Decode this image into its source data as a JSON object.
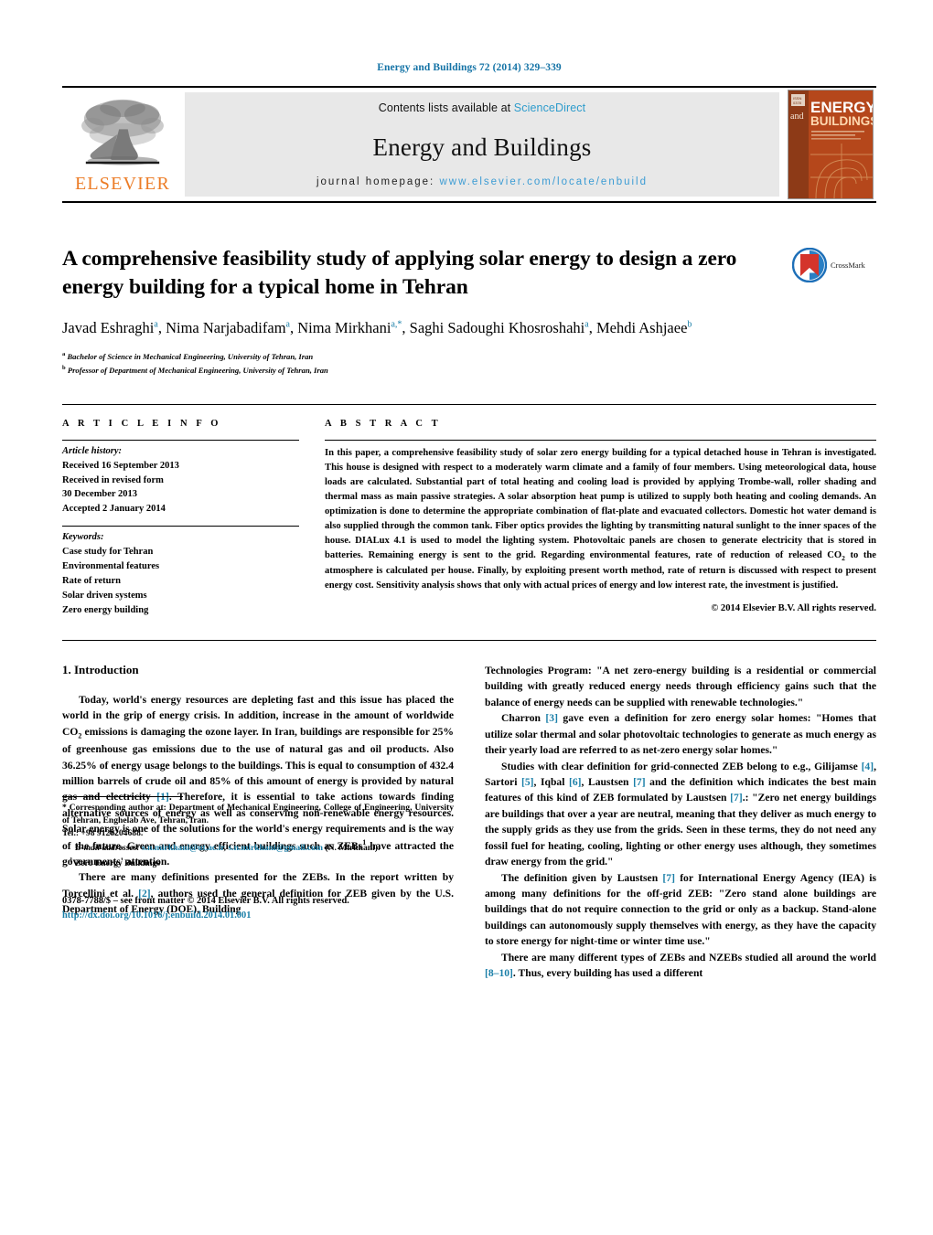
{
  "running_head": "Energy and Buildings 72 (2014) 329–339",
  "masthead": {
    "publisher_name": "ELSEVIER",
    "contents_prefix": "Contents lists available at ",
    "contents_link": "ScienceDirect",
    "journal_name": "Energy and Buildings",
    "homepage_prefix": "journal homepage: ",
    "homepage_url": "www.elsevier.com/locate/enbuild",
    "cover_title_line1": "ENERGY",
    "cover_title_line2": "BUILDINGS",
    "cover_and": "and"
  },
  "article": {
    "title": "A comprehensive feasibility study of applying solar energy to design a zero energy building for a typical home in Tehran",
    "crossmark_label": "CrossMark",
    "authors_html": "Javad Eshraghi<sup>a</sup>, Nima Narjabadifam<sup>a</sup>, Nima Mirkhani<sup>a,*</sup>, Saghi Sadoughi Khosroshahi<sup>a</sup>, Mehdi Ashjaee<sup>b</sup>",
    "affiliations": [
      "Bachelor of Science in Mechanical Engineering, University of Tehran, Iran",
      "Professor of Department of Mechanical Engineering, University of Tehran, Iran"
    ],
    "affiliation_marks": [
      "a",
      "b"
    ]
  },
  "article_info": {
    "heading": "A R T I C L E    I N F O",
    "history_label": "Article history:",
    "history_lines": [
      "Received 16 September 2013",
      "Received in revised form",
      "30 December 2013",
      "Accepted 2 January 2014"
    ],
    "keywords_label": "Keywords:",
    "keywords": [
      "Case study for Tehran",
      "Environmental features",
      "Rate of return",
      "Solar driven systems",
      "Zero energy building"
    ]
  },
  "abstract": {
    "heading": "A B S T R A C T",
    "text_html": "In this paper, a comprehensive feasibility study of solar zero energy building for a typical detached house in Tehran is investigated. This house is designed with respect to a moderately warm climate and a family of four members. Using meteorological data, house loads are calculated. Substantial part of total heating and cooling load is provided by applying Trombe-wall, roller shading and thermal mass as main passive strategies. A solar absorption heat pump is utilized to supply both heating and cooling demands. An optimization is done to determine the appropriate combination of flat-plate and evacuated collectors. Domestic hot water demand is also supplied through the common tank. Fiber optics provides the lighting by transmitting natural sunlight to the inner spaces of the house. DIALux 4.1 is used to model the lighting system. Photovoltaic panels are chosen to generate electricity that is stored in batteries. Remaining energy is sent to the grid. Regarding environmental features, rate of reduction of released CO<sub>2</sub> to the atmosphere is calculated per house. Finally, by exploiting present worth method, rate of return is discussed with respect to present energy cost. Sensitivity analysis shows that only with actual prices of energy and low interest rate, the investment is justified.",
    "copyright": "© 2014 Elsevier B.V. All rights reserved."
  },
  "body": {
    "section_number_title": "1.  Introduction",
    "left_paragraphs_html": [
      "Today, world's energy resources are depleting fast and this issue has placed the world in the grip of energy crisis. In addition, increase in the amount of worldwide CO<sub>2</sub> emissions is damaging the ozone layer. In Iran, buildings are responsible for 25% of greenhouse gas emissions due to the use of natural gas and oil products. Also 36.25% of energy usage belongs to the buildings. This is equal to consumption of 432.4 million barrels of crude oil and 85% of this amount of energy is provided by natural gas and electricity <span class=\"ref\">[1]</span>. Therefore, it is essential to take actions towards finding alternative sources of energy as well as conserving non-renewable energy resources. Solar energy is one of the solutions for the world's energy requirements and is the way of the future. Green and energy efficient buildings such as ZEBs<sup>1</sup> have attracted the governments' attention.",
      "There are many definitions presented for the ZEBs. In the report written by Torcellini et al. <span class=\"ref\">[2]</span>, authors used the general definition for ZEB given by the U.S. Department of Energy (DOE), Building"
    ],
    "right_paragraphs_html": [
      "Technologies Program: \"A net zero-energy building is a residential or commercial building with greatly reduced energy needs through efficiency gains such that the balance of energy needs can be supplied with renewable technologies.\"",
      "Charron <span class=\"ref\">[3]</span> gave even a definition for zero energy solar homes: \"Homes that utilize solar thermal and solar photovoltaic technologies to generate as much energy as their yearly load are referred to as net-zero energy solar homes.\"",
      "Studies with clear definition for grid-connected ZEB belong to e.g., Gilijamse <span class=\"ref\">[4]</span>, Sartori <span class=\"ref\">[5]</span>, Iqbal <span class=\"ref\">[6]</span>, Laustsen <span class=\"ref\">[7]</span> and the definition which indicates the best main features of this kind of ZEB formulated by Laustsen <span class=\"ref\">[7]</span>.: \"Zero net energy buildings are buildings that over a year are neutral, meaning that they deliver as much energy to the supply grids as they use from the grids. Seen in these terms, they do not need any fossil fuel for heating, cooling, lighting or other energy uses although, they sometimes draw energy from the grid.\"",
      "The definition given by Laustsen <span class=\"ref\">[7]</span> for International Energy Agency (IEA) is among many definitions for the off-grid ZEB: \"Zero stand alone buildings are buildings that do not require connection to the grid or only as a backup. Stand-alone buildings can autonomously supply themselves with energy, as they have the capacity to store energy for night-time or winter time use.\"",
      "There are many different types of ZEBs and NZEBs studied all around the world <span class=\"ref\">[8–10]</span>. Thus, every building has used a different"
    ]
  },
  "footnotes": {
    "corresponding_html": "<b>*</b>  Corresponding author at: Department of Mechanical Engineering, College of Engineering, University of Tehran, Enghelab Ave, Tehran, Iran.<br>Tel.: +98 9128204688.",
    "email_html": "<i>E-mail addresses:</i> <span class=\"mail\">s.n.mirkhani@ut.ac.ir</span>, <span class=\"mail\">s.n.mirkhani@gmail.com</span> (N. Mirkhani).",
    "footnote1_html": "<sup>1</sup>  Zero Energy Buildings"
  },
  "imprint": {
    "line1": "0378-7788/$ – see front matter © 2014 Elsevier B.V. All rights reserved.",
    "doi": "http://dx.doi.org/10.1016/j.enbuild.2014.01.001"
  }
}
